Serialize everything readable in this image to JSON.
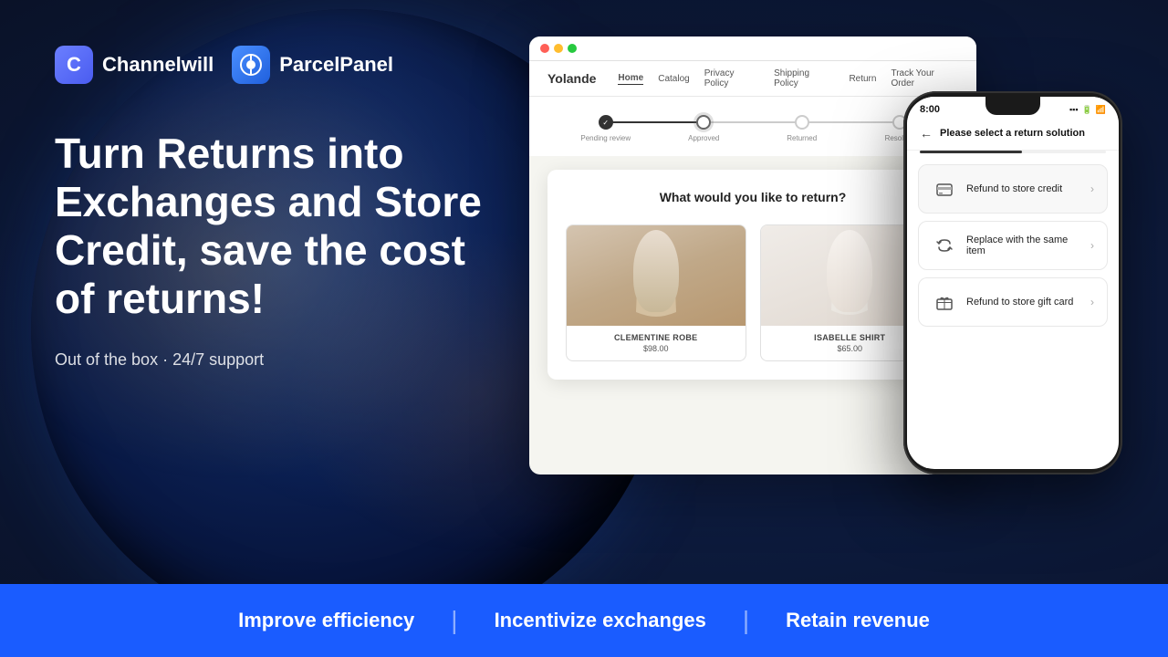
{
  "brand": {
    "channelwill": {
      "icon": "C",
      "name": "Channelwill"
    },
    "parcelpanel": {
      "name": "ParcelPanel"
    }
  },
  "hero": {
    "headline": "Turn Returns into Exchanges and Store Credit,  save the cost of returns!",
    "subtext": "Out of the box · 24/7 support"
  },
  "store": {
    "name": "Yolande",
    "nav_items": [
      "Home",
      "Catalog",
      "Privacy Policy",
      "Shipping Policy",
      "Return",
      "Track Your Order"
    ]
  },
  "progress": {
    "steps": [
      "Pending review",
      "Approved",
      "Returned",
      "Resolved"
    ],
    "active_step": 1
  },
  "modal": {
    "title": "What would you like to return?",
    "close_label": "×",
    "products": [
      {
        "name": "CLEMENTINE ROBE",
        "price": "$98.00"
      },
      {
        "name": "ISABELLE SHIRT",
        "price": "$65.00"
      }
    ]
  },
  "phone": {
    "time": "8:00",
    "header_title": "Please select a return solution",
    "options": [
      {
        "icon": "🔒",
        "text": "Refund to store credit"
      },
      {
        "icon": "🔄",
        "text": "Replace with the same item"
      },
      {
        "icon": "🎁",
        "text": "Refund to store gift card"
      }
    ]
  },
  "bottom_bar": {
    "items": [
      "Improve efficiency",
      "Incentivize exchanges",
      "Retain revenue"
    ]
  }
}
